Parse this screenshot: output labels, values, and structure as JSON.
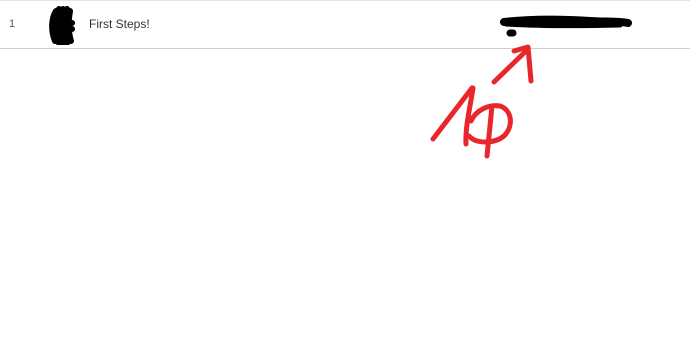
{
  "row": {
    "index": "1",
    "title": "First Steps!"
  },
  "colors": {
    "redaction": "#000000",
    "annotation": "#e8262c",
    "divider": "#cfcfcf",
    "row_text": "#333333"
  },
  "icons": {
    "avatar": "redacted-avatar-scribble",
    "value": "redacted-value-scribble",
    "annotation": "hand-drawn-arrow-and-symbol"
  }
}
